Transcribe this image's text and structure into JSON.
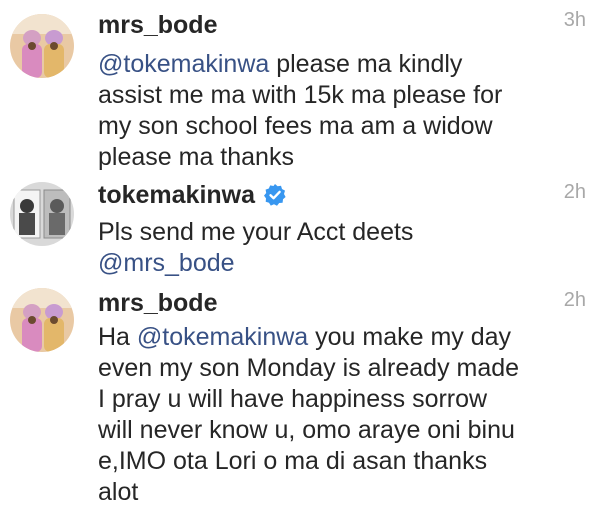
{
  "comments": [
    {
      "username": "mrs_bode",
      "time": "3h",
      "verified": false,
      "mention": "@tokemakinwa",
      "lines": [
        " please ma kindly",
        "assist me ma with 15k ma please for",
        "my son school fees ma am a widow",
        "please ma thanks"
      ]
    },
    {
      "username": "tokemakinwa",
      "time": "2h",
      "verified": true,
      "lines": [
        "Pls send me your Acct deets"
      ],
      "mention_end": "@mrs_bode"
    },
    {
      "username": "mrs_bode",
      "time": "2h",
      "verified": false,
      "prefix": "Ha ",
      "mention": "@tokemakinwa",
      "lines": [
        " you make my day",
        "even my son Monday is already made",
        "I pray u will have happiness sorrow",
        "will never know u, omo araye oni binu",
        "e,IMO ota  Lori o ma di asan  thanks",
        "alot"
      ]
    }
  ],
  "icons": {
    "verified": "verified-badge-icon",
    "avatar_mrs_bode": "avatar-photo",
    "avatar_tokemakinwa": "avatar-photo"
  },
  "colors": {
    "mention": "#385185",
    "verified": "#3897f0",
    "timestamp": "#a8a8a8"
  }
}
